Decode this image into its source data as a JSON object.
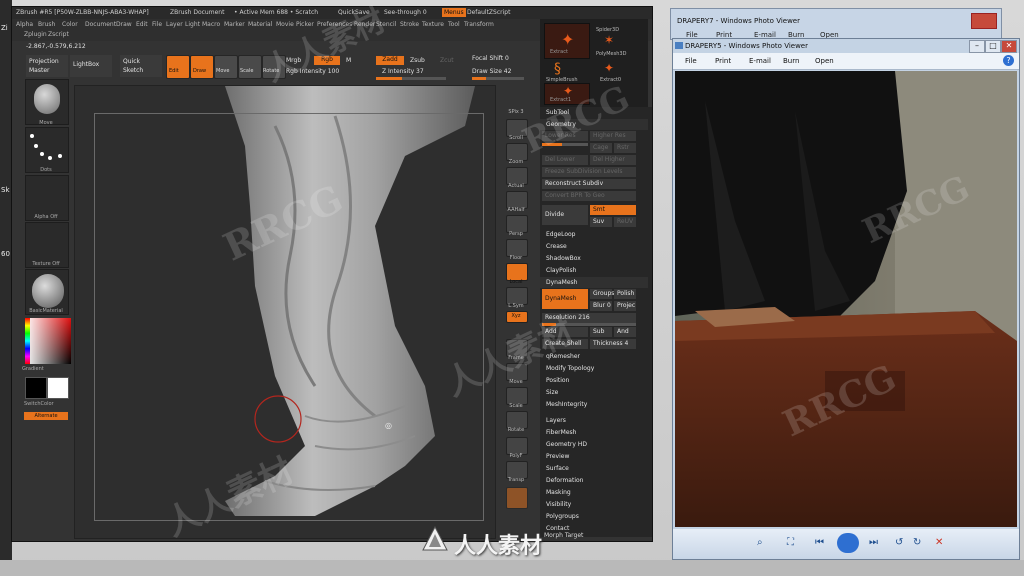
{
  "desktop": {
    "left_labels": [
      "Zi",
      "Sk",
      "60"
    ]
  },
  "photo_viewer_back": {
    "title": "DRAPERY7 - Windows Photo Viewer",
    "menu": [
      "File",
      "Print",
      "E-mail",
      "Burn",
      "Open"
    ]
  },
  "photo_viewer": {
    "title": "DRAPERY5 - Windows Photo Viewer",
    "menu": {
      "file": "File",
      "print": "Print",
      "email": "E-mail",
      "burn": "Burn",
      "open": "Open",
      "help": "?"
    },
    "window_buttons": {
      "min": "–",
      "max": "□",
      "close": "✕"
    }
  },
  "zbrush": {
    "title_items": {
      "app": "ZBrush #R5 [P50W-ZLBB-NNJS-ABA3-WHAP]",
      "doc": "ZBrush Document",
      "mem": "• Active Mem 688 • Scratch",
      "quicksave": "QuickSave",
      "seethrough": "See-through  0",
      "menus": "Menus",
      "script": "DefaultZScript"
    },
    "menus": [
      "Alpha",
      "Brush",
      "Color",
      "Document",
      "Draw",
      "Edit",
      "File",
      "Layer",
      "Light",
      "Macro",
      "Marker",
      "Material",
      "Movie",
      "Picker",
      "Preferences",
      "Render",
      "Stencil",
      "Stroke",
      "Texture",
      "Tool",
      "Transform",
      "Zplugin",
      "Zscript"
    ],
    "coords": "-2.867,-0.579,6.212",
    "topbar": {
      "projection_master": "Projection Master",
      "lightbox": "LightBox",
      "quick_sketch": "Quick Sketch",
      "edit": "Edit",
      "draw": "Draw",
      "move": "Move",
      "scale": "Scale",
      "rotate": "Rotate",
      "mrgb": "Mrgb",
      "rgb": "Rgb",
      "m": "M",
      "rgb_intensity": "Rgb Intensity 100",
      "zadd": "Zadd",
      "zsub": "Zsub",
      "zcut": "Zcut",
      "z_intensity": "Z Intensity 37",
      "focal_shift": "Focal Shift 0",
      "draw_size": "Draw Size 42"
    },
    "left_shelf": {
      "move": "Move",
      "dots": "Dots",
      "alpha_off": "Alpha Off",
      "texture_off": "Texture Off",
      "basic_material": "BasicMaterial",
      "gradient": "Gradient",
      "switch_color": "SwitchColor",
      "alternate": "Alternate"
    },
    "right_tools": [
      "SPix 3",
      "Scroll",
      "Zoom",
      "Actual",
      "AAHalf",
      "Persp",
      "Floor",
      "Local",
      "L.Sym",
      "Xyz",
      "",
      "Frame",
      "Move",
      "Scale",
      "Rotate",
      "PolyF",
      "Transp"
    ],
    "subtool_icons": {
      "extract": "Extract",
      "spider3d": "Spider3D",
      "polymesh3d": "PolyMesh3D",
      "simplebrush": "SimpleBrush",
      "extract0": "Extract0",
      "extract1": "Extract1"
    },
    "panel": {
      "subtool": "SubTool",
      "geometry": "Geometry",
      "lower_res": "Lower Res",
      "higher_res": "Higher Res",
      "cage": "Cage",
      "rstr": "Rstr",
      "del_lower": "Del Lower",
      "del_higher": "Del Higher",
      "freeze_subdiv": "Freeze SubDivision Levels",
      "reconstruct_subdiv": "Reconstruct Subdiv",
      "convert_bpr": "Convert BPR To Geo",
      "divide": "Divide",
      "smt": "Smt",
      "suv": "Suv",
      "reuv": "ReUV",
      "edgeloop": "EdgeLoop",
      "crease": "Crease",
      "shadowbox": "ShadowBox",
      "claypolish": "ClayPolish",
      "dynamesh_head": "DynaMesh",
      "dynamesh_btn": "DynaMesh",
      "groups": "Groups",
      "polish": "Polish",
      "blur": "Blur 0",
      "project": "Projec",
      "resolution": "Resolution 216",
      "add": "Add",
      "sub": "Sub",
      "and": "And",
      "create_shell": "Create Shell",
      "thickness": "Thickness 4",
      "qremesher": "qRemesher",
      "modify_topology": "Modify Topology",
      "position": "Position",
      "size": "Size",
      "meshintegrity": "MeshIntegrity",
      "layers": "Layers",
      "fibermesh": "FiberMesh",
      "geometry_hd": "Geometry HD",
      "preview": "Preview",
      "surface": "Surface",
      "deformation": "Deformation",
      "masking": "Masking",
      "visibility": "Visibility",
      "polygroups": "Polygroups",
      "contact": "Contact",
      "morph_target": "Morph Target"
    }
  },
  "watermarks": [
    "RRCG",
    "人人素材",
    "RRCG",
    "人人素材",
    "RRCG",
    "人人素材",
    "RRCG"
  ],
  "logo_text": "人人素材",
  "colors": {
    "accent": "#e8731c",
    "zbrush_bg": "#333333"
  }
}
